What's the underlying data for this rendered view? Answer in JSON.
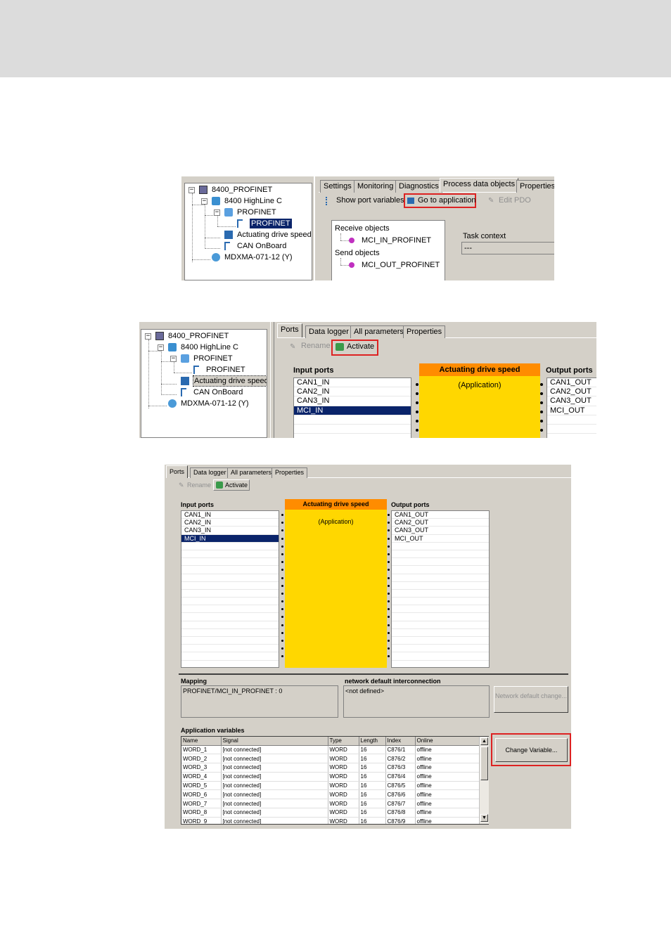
{
  "tree": {
    "root": "8400_PROFINET",
    "controller": "8400 HighLine C",
    "profinet_folder": "PROFINET",
    "profinet_port": "PROFINET",
    "app": "Actuating drive speed",
    "can": "CAN OnBoard",
    "motor": "MDXMA-071-12 (Y)"
  },
  "shot1": {
    "tabs": [
      "Settings",
      "Monitoring",
      "Diagnostics",
      "Process data objects",
      "Properties"
    ],
    "show_port_variables": "Show port variables",
    "go_to_application": "Go to application",
    "edit_pdo": "Edit PDO",
    "receive_objects": "Receive objects",
    "mci_in": "MCI_IN_PROFINET",
    "send_objects": "Send objects",
    "mci_out": "MCI_OUT_PROFINET",
    "task_context": "Task context",
    "task_value": "---"
  },
  "shot2": {
    "tabs": [
      "Ports",
      "Data logger",
      "All parameters",
      "Properties"
    ],
    "rename": "Rename",
    "activate": "Activate",
    "input_ports": "Input ports",
    "output_ports": "Output ports",
    "app_title": "Actuating drive speed",
    "app_sub": "(Application)",
    "inputs": [
      "CAN1_IN",
      "CAN2_IN",
      "CAN3_IN",
      "MCI_IN"
    ],
    "outputs": [
      "CAN1_OUT",
      "CAN2_OUT",
      "CAN3_OUT",
      "MCI_OUT"
    ]
  },
  "shot3": {
    "tabs": [
      "Ports",
      "Data logger",
      "All parameters",
      "Properties"
    ],
    "rename": "Rename",
    "activate": "Activate",
    "input_ports": "Input ports",
    "output_ports": "Output ports",
    "app_title": "Actuating drive speed",
    "app_sub": "(Application)",
    "inputs": [
      "CAN1_IN",
      "CAN2_IN",
      "CAN3_IN",
      "MCI_IN"
    ],
    "outputs": [
      "CAN1_OUT",
      "CAN2_OUT",
      "CAN3_OUT",
      "MCI_OUT"
    ],
    "mapping_label": "Mapping",
    "mapping_value": "PROFINET/MCI_IN_PROFINET : 0",
    "network_label": "network default interconnection",
    "network_value": "<not defined>",
    "network_button": "Network default change...",
    "appvars_label": "Application variables",
    "change_variable": "Change Variable...",
    "columns": [
      "Name",
      "Signal",
      "Type",
      "Length",
      "Index",
      "Online"
    ],
    "rows": [
      [
        "WORD_1",
        "[not connected]",
        "WORD",
        "16",
        "C876/1",
        "offline"
      ],
      [
        "WORD_2",
        "[not connected]",
        "WORD",
        "16",
        "C876/2",
        "offline"
      ],
      [
        "WORD_3",
        "[not connected]",
        "WORD",
        "16",
        "C876/3",
        "offline"
      ],
      [
        "WORD_4",
        "[not connected]",
        "WORD",
        "16",
        "C876/4",
        "offline"
      ],
      [
        "WORD_5",
        "[not connected]",
        "WORD",
        "16",
        "C876/5",
        "offline"
      ],
      [
        "WORD_6",
        "[not connected]",
        "WORD",
        "16",
        "C876/6",
        "offline"
      ],
      [
        "WORD_7",
        "[not connected]",
        "WORD",
        "16",
        "C876/7",
        "offline"
      ],
      [
        "WORD_8",
        "[not connected]",
        "WORD",
        "16",
        "C876/8",
        "offline"
      ],
      [
        "WORD_9",
        "[not connected]",
        "WORD",
        "16",
        "C876/9",
        "offline"
      ]
    ]
  },
  "colors": {
    "app_body": "#ffd700",
    "app_header": "#ff8c00",
    "selection": "#0a246a",
    "highlight_frame": "#dd2222"
  }
}
